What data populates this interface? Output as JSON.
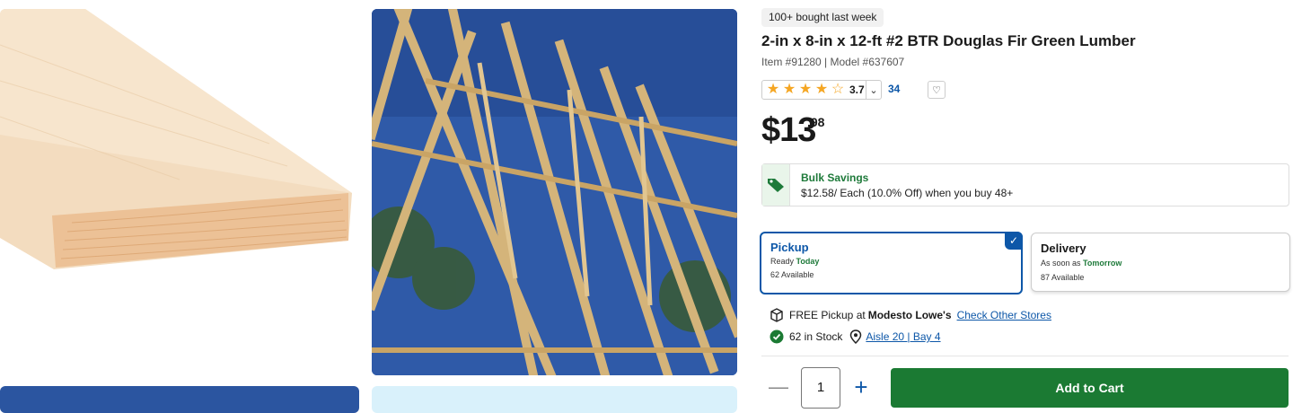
{
  "badge": "100+ bought last week",
  "product": {
    "title": "2-in x 8-in x 12-ft #2 BTR Douglas Fir Green Lumber",
    "meta": "Item #91280 | Model #637607"
  },
  "rating": {
    "stars": 3.7,
    "score": "3.7",
    "reviews": "34",
    "star_color": "#f5a623"
  },
  "price": {
    "dollars": "$13",
    "cents": ".98"
  },
  "bulk": {
    "title": "Bulk Savings",
    "detail": "$12.58/ Each (10.0% Off) when you buy 48+",
    "icon": "price-tag-icon",
    "color": "#1e7a3a"
  },
  "fulfillment": {
    "pickup": {
      "label": "Pickup",
      "status_prefix": "Ready ",
      "status_value": "Today",
      "available": "62 Available",
      "selected": true
    },
    "delivery": {
      "label": "Delivery",
      "status_prefix": "As soon as ",
      "status_value": "Tomorrow",
      "available": "87 Available"
    }
  },
  "store": {
    "pickup_prefix": "FREE Pickup at ",
    "store_name": "Modesto Lowe's",
    "check_other": "Check Other Stores",
    "stock": "62 in Stock",
    "aisle": "Aisle 20 | Bay 4"
  },
  "quantity": {
    "value": "1"
  },
  "cart": {
    "label": "Add to Cart",
    "color": "#1b7a33"
  },
  "accent": "#0d57a8"
}
